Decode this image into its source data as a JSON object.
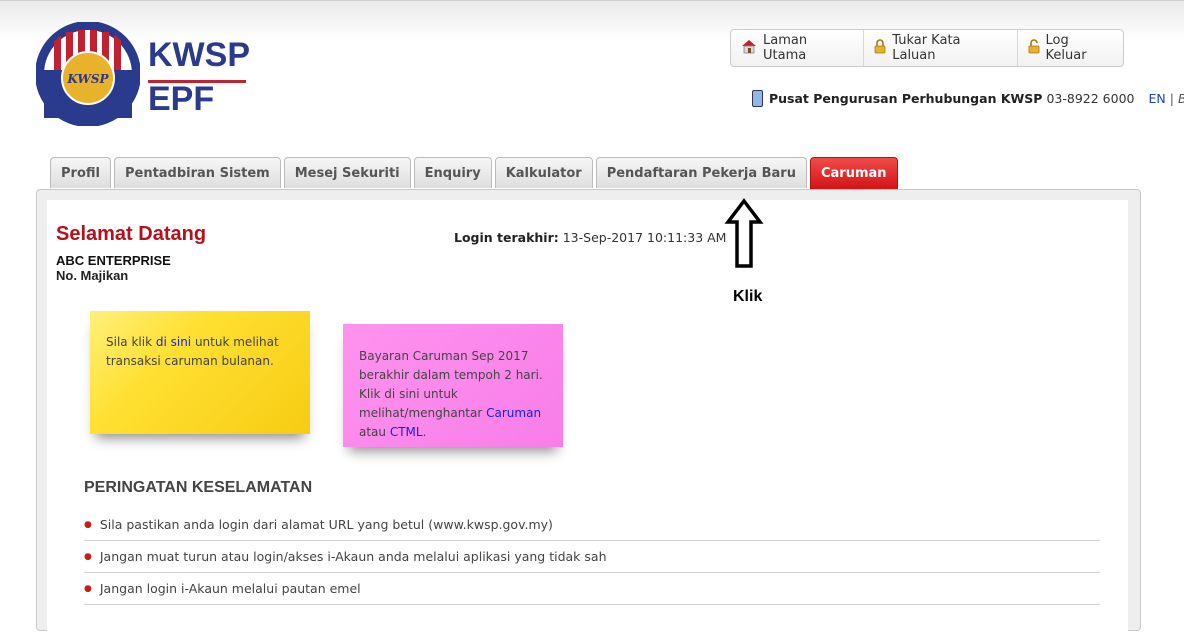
{
  "brand": {
    "line1": "KWSP",
    "line2": "EPF",
    "emblem_text": "KWSP",
    "colors": {
      "navy": "#2a3a8c",
      "red": "#c02232",
      "gold": "#e8b22a"
    }
  },
  "toolbar": {
    "items": [
      {
        "label": "Laman Utama",
        "icon": "home-icon"
      },
      {
        "label": "Tukar Kata Laluan",
        "icon": "lock-icon"
      },
      {
        "label": "Log Keluar",
        "icon": "logout-lock-icon"
      }
    ]
  },
  "contact": {
    "label": "Pusat Pengurusan Perhubungan KWSP",
    "phone": "03-8922 6000",
    "lang_en": "EN",
    "lang_sep": "|",
    "lang_bm": "BM"
  },
  "tabs": [
    {
      "label": "Profil",
      "active": false
    },
    {
      "label": "Pentadbiran Sistem",
      "active": false
    },
    {
      "label": "Mesej Sekuriti",
      "active": false
    },
    {
      "label": "Enquiry",
      "active": false
    },
    {
      "label": "Kalkulator",
      "active": false
    },
    {
      "label": "Pendaftaran Pekerja Baru",
      "active": false
    },
    {
      "label": "Caruman",
      "active": true
    }
  ],
  "welcome": {
    "title": "Selamat Datang",
    "company": "ABC ENTERPRISE",
    "majikan_label": "No. Majikan",
    "last_login_label": "Login terakhir:",
    "last_login_value": "13-Sep-2017 10:11:33 AM"
  },
  "annotation": {
    "label": "Klik"
  },
  "note_yellow": {
    "pre": "Sila klik ",
    "link": "di sini",
    "post": " untuk melihat transaksi caruman bulanan."
  },
  "note_pink": {
    "line1": "Bayaran Caruman Sep 2017 berakhir dalam tempoh 2 hari.",
    "line2_pre": "Klik di sini untuk melihat/menghantar ",
    "link1": "Caruman",
    "mid": " atau ",
    "link2": "CTML",
    "end": "."
  },
  "security": {
    "title": "PERINGATAN KESELAMATAN",
    "items": [
      "Sila pastikan anda login dari alamat URL yang betul (www.kwsp.gov.my)",
      "Jangan muat turun atau login/akses i-Akaun anda melalui aplikasi yang tidak sah",
      "Jangan login i-Akaun melalui pautan emel"
    ]
  }
}
